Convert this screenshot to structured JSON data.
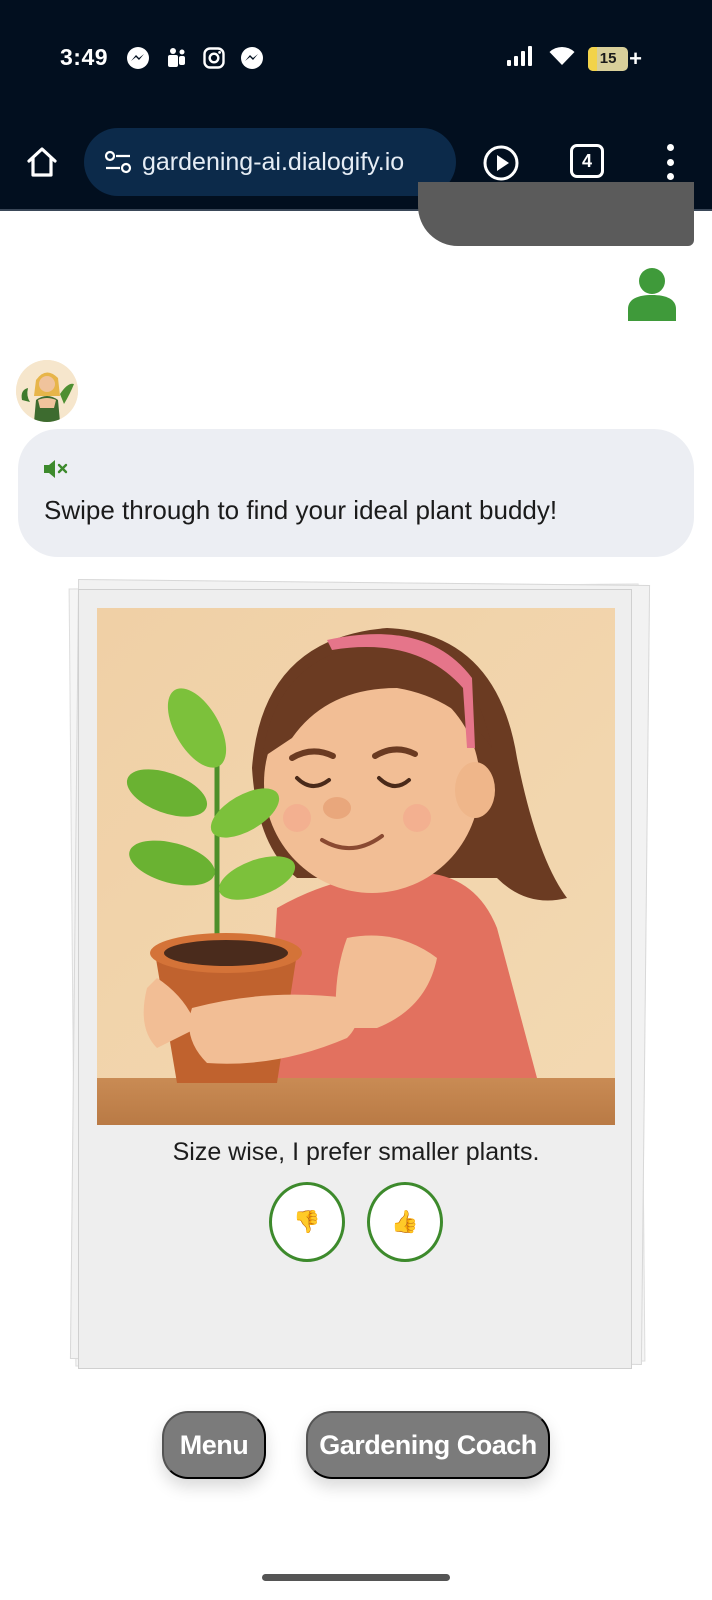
{
  "status_bar": {
    "time": "3:49",
    "battery_level": "15",
    "battery_charging": "+"
  },
  "browser": {
    "url": "gardening-ai.dialogify.io",
    "tab_count": "4"
  },
  "chat": {
    "bot_message": "Swipe through to find your ideal plant buddy!"
  },
  "card": {
    "caption": "Size wise, I prefer smaller plants.",
    "dislike_emoji": "👎",
    "like_emoji": "👍"
  },
  "nav": {
    "menu_label": "Menu",
    "coach_label": "Gardening Coach"
  },
  "colors": {
    "accent_green": "#3d8a2c",
    "top_bar": "#020f1f",
    "nav_button": "#7b7b7b"
  }
}
